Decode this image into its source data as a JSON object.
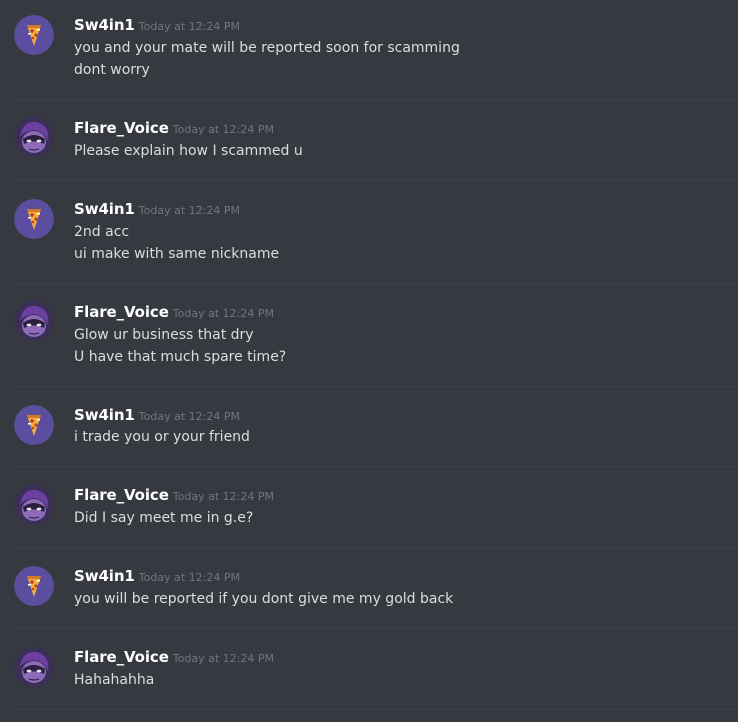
{
  "users": {
    "sw": "Sw4in1",
    "fv": "Flare_Voice"
  },
  "timestamp": "Today at 12:24 PM",
  "messages": [
    {
      "lines": [
        "you and your mate will be reported soon for scamming",
        "dont worry"
      ]
    },
    {
      "lines": [
        "Please explain how I scammed u"
      ]
    },
    {
      "lines": [
        "2nd acc",
        "ui make with same nickname"
      ]
    },
    {
      "lines": [
        "Glow ur business that dry",
        "U have that much spare time?"
      ]
    },
    {
      "lines": [
        "i trade you or your friend"
      ]
    },
    {
      "lines": [
        "Did I say meet me in g.e?"
      ]
    },
    {
      "lines": [
        "you will be reported if you dont give me my gold back"
      ]
    },
    {
      "lines": [
        "Hahahahha"
      ]
    }
  ],
  "colors": {
    "background": "#36393f",
    "username": "#ffffff",
    "timestamp": "#72767d",
    "message": "#dcddde",
    "sw_avatar_bg": "#5b4e9e",
    "fv_avatar_bg": "#3a2f55"
  },
  "icons": {
    "sw_avatar": "pizza-avatar-icon",
    "fv_avatar": "masked-character-avatar-icon"
  }
}
